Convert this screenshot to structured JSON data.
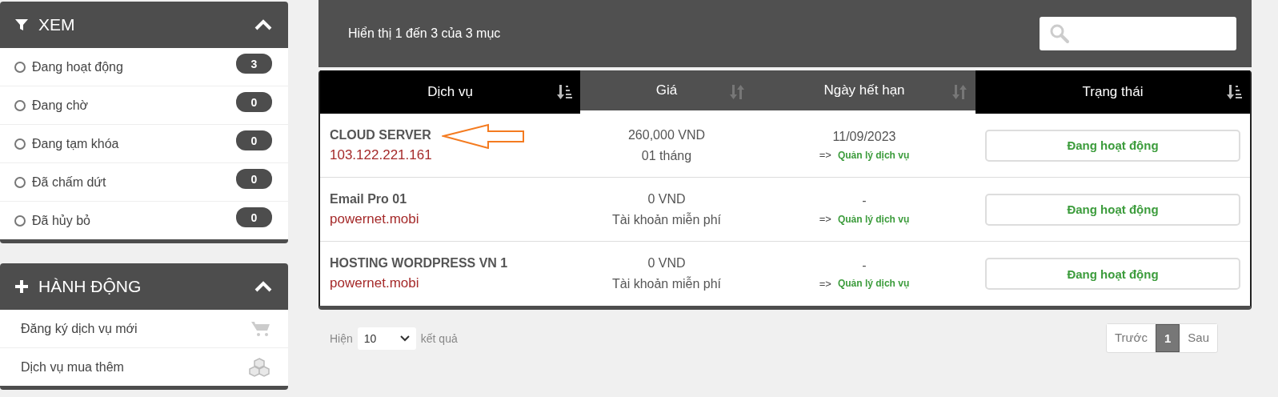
{
  "filter_panel": {
    "title": "XEM",
    "items": [
      {
        "label": "Đang hoạt động",
        "count": "3",
        "selected": false
      },
      {
        "label": "Đang chờ",
        "count": "0",
        "selected": false
      },
      {
        "label": "Đang tạm khóa",
        "count": "0",
        "selected": false
      },
      {
        "label": "Đã chấm dứt",
        "count": "0",
        "selected": false
      },
      {
        "label": "Đã hủy bỏ",
        "count": "0",
        "selected": false
      }
    ]
  },
  "actions_panel": {
    "title": "HÀNH ĐỘNG",
    "items": [
      {
        "label": "Đăng ký dịch vụ mới",
        "kind": "cart"
      },
      {
        "label": "Dịch vụ mua thêm",
        "kind": "cubes"
      }
    ]
  },
  "listing": {
    "summary": "Hiển thị 1 đến 3 của 3 mục"
  },
  "table": {
    "columns": [
      {
        "label": "Dịch vụ",
        "sorted": true
      },
      {
        "label": "Giá",
        "sorted": false
      },
      {
        "label": "Ngày hết hạn",
        "sorted": false
      },
      {
        "label": "Trạng thái",
        "sorted": true
      }
    ],
    "rows": [
      {
        "service": "CLOUD SERVER",
        "domain": "103.122.221.161",
        "price": "260,000 VND",
        "cycle": "01 tháng",
        "due": "11/09/2023",
        "pointer": "=>",
        "link": "Quản lý dịch vụ",
        "status": "Đang hoạt động",
        "annotated": true
      },
      {
        "service": "Email Pro 01",
        "domain": "powernet.mobi",
        "price": "0 VND",
        "cycle": "Tài khoản miễn phí",
        "due": "-",
        "pointer": "=>",
        "link": "Quản lý dịch vụ",
        "status": "Đang hoạt động",
        "annotated": false
      },
      {
        "service": "HOSTING WORDPRESS VN 1",
        "domain": "powernet.mobi",
        "price": "0 VND",
        "cycle": "Tài khoản miễn phí",
        "due": "-",
        "pointer": "=>",
        "link": "Quản lý dịch vụ",
        "status": "Đang hoạt động",
        "annotated": false
      }
    ]
  },
  "footer": {
    "show_label": "Hiện",
    "page_size": "10",
    "results_label": "kết quả",
    "pagination": [
      {
        "label": "Trước",
        "selected": false
      },
      {
        "label": "1",
        "selected": true
      },
      {
        "label": "Sau",
        "selected": false
      }
    ]
  }
}
